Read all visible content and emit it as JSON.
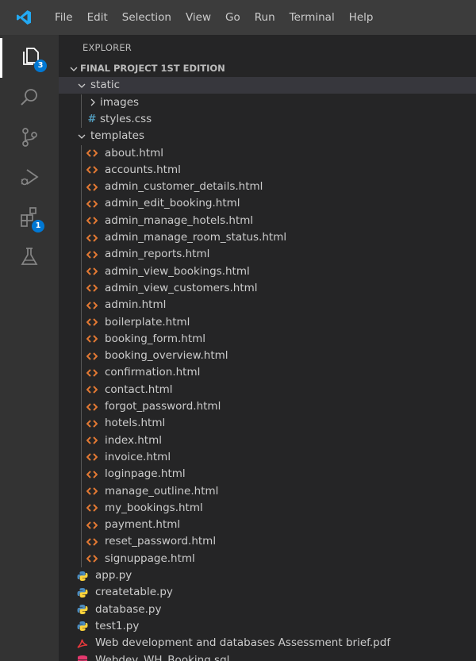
{
  "menu": [
    "File",
    "Edit",
    "Selection",
    "View",
    "Go",
    "Run",
    "Terminal",
    "Help"
  ],
  "activity": {
    "explorer_badge": "3",
    "extensions_badge": "1"
  },
  "explorer": {
    "title": "EXPLORER",
    "root": "FINAL PROJECT 1ST EDITION",
    "static_folder": "static",
    "images_folder": "images",
    "styles_file": "styles.css",
    "templates_folder": "templates",
    "templates": [
      "about.html",
      "accounts.html",
      "admin_customer_details.html",
      "admin_edit_booking.html",
      "admin_manage_hotels.html",
      "admin_manage_room_status.html",
      "admin_reports.html",
      "admin_view_bookings.html",
      "admin_view_customers.html",
      "admin.html",
      "boilerplate.html",
      "booking_form.html",
      "booking_overview.html",
      "confirmation.html",
      "contact.html",
      "forgot_password.html",
      "hotels.html",
      "index.html",
      "invoice.html",
      "loginpage.html",
      "manage_outline.html",
      "my_bookings.html",
      "payment.html",
      "reset_password.html",
      "signuppage.html"
    ],
    "python_files": [
      "app.py",
      "createtable.py",
      "database.py",
      "test1.py"
    ],
    "pdf_file": "Web development and databases Assessment brief.pdf",
    "sql_file": "Webdev_WH_Booking.sql"
  },
  "colors": {
    "html_icon": "#e37933",
    "css_icon": "#519aba",
    "python_icon": "#4b8bbe",
    "pdf_icon": "#e5383b",
    "sql_icon": "#e5386e",
    "badge": "#0078d4",
    "logo": "#23a9f2"
  }
}
